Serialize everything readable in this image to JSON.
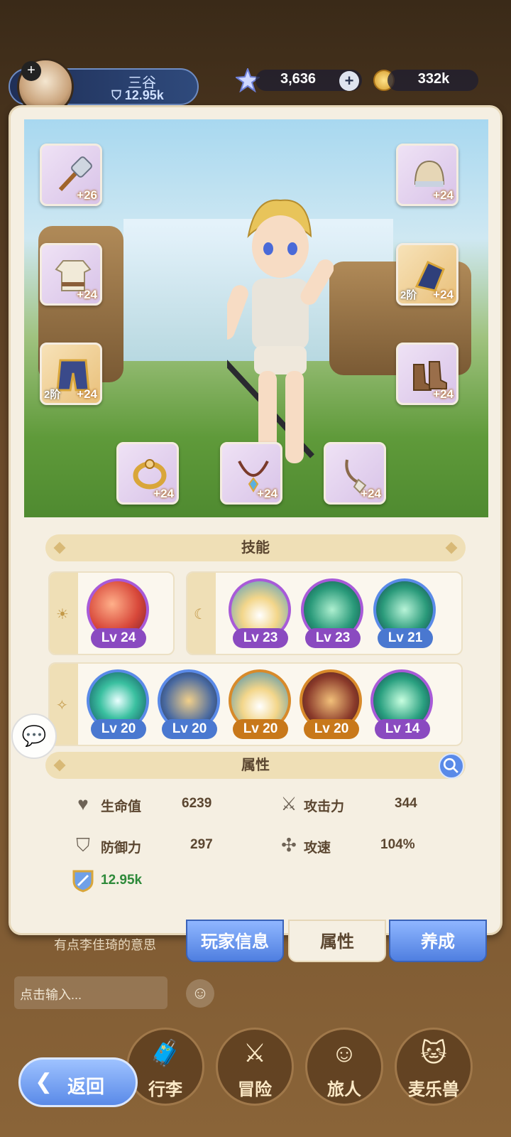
{
  "player": {
    "name": "三谷",
    "power": "12.95k"
  },
  "currency": {
    "gems": "3,636",
    "coins": "332k"
  },
  "equipment": {
    "weapon": {
      "level": "+26"
    },
    "helmet": {
      "level": "+24"
    },
    "armor": {
      "level": "+24"
    },
    "gloves": {
      "level": "+24",
      "tier": "2阶"
    },
    "pants": {
      "level": "+24",
      "tier": "2阶"
    },
    "boots": {
      "level": "+24"
    },
    "ring": {
      "level": "+24"
    },
    "necklace": {
      "level": "+24"
    },
    "amulet": {
      "level": "+24"
    }
  },
  "sections": {
    "skills": "技能",
    "attributes": "属性"
  },
  "skills": {
    "sun": [
      {
        "level": "Lv 24"
      }
    ],
    "moon": [
      {
        "level": "Lv 23"
      },
      {
        "level": "Lv 23"
      },
      {
        "level": "Lv 21"
      }
    ],
    "star": [
      {
        "level": "Lv 20"
      },
      {
        "level": "Lv 20"
      },
      {
        "level": "Lv 20"
      },
      {
        "level": "Lv 20"
      },
      {
        "level": "Lv 14"
      }
    ]
  },
  "attributes": {
    "hp_label": "生命值",
    "hp_value": "6239",
    "atk_label": "攻击力",
    "atk_value": "344",
    "def_label": "防御力",
    "def_value": "297",
    "spd_label": "攻速",
    "spd_value": "104%",
    "combat_power": "12.95k"
  },
  "tabs": {
    "player_info": "玩家信息",
    "attributes": "属性",
    "develop": "养成"
  },
  "chat": {
    "last_message": "有点李佳琦的意思",
    "input_placeholder": "点击输入..."
  },
  "nav": {
    "back": "返回",
    "bag": "行李",
    "adventure": "冒险",
    "traveler": "旅人",
    "pet": "麦乐兽"
  },
  "colors": {
    "accent_blue": "#5a8ae8",
    "panel_bg": "#f5efe2",
    "combat_green": "#2e8a3a"
  }
}
